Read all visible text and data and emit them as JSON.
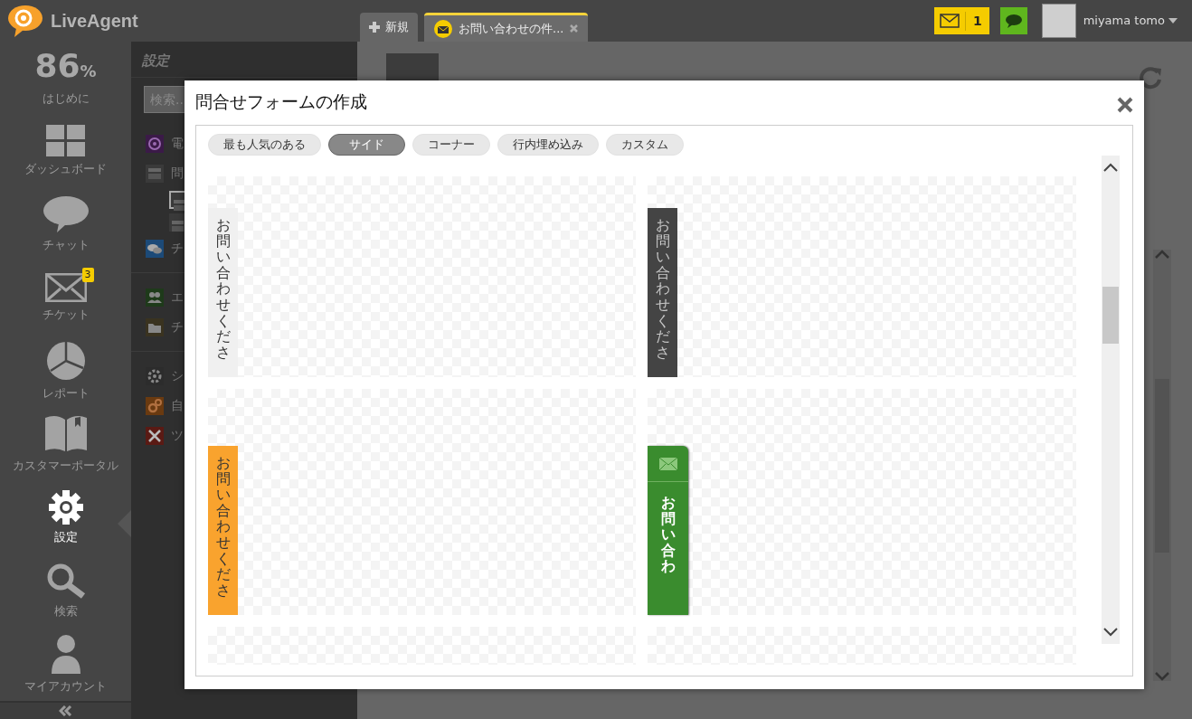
{
  "app": {
    "logo": "LiveAgent"
  },
  "tabs": [
    {
      "label": "新規",
      "kind": "new",
      "selected": false
    },
    {
      "label": "お問い合わせの件...",
      "kind": "ticket",
      "selected": true
    }
  ],
  "header": {
    "mail_count": "1",
    "user": "miyama tomo"
  },
  "nav": {
    "progress": "86",
    "progress_unit": "%",
    "progress_label": "はじめに",
    "items": [
      {
        "label": "ダッシュボード",
        "selected": false
      },
      {
        "label": "チャット",
        "selected": false
      },
      {
        "label": "チケット",
        "badge": "3",
        "selected": false
      },
      {
        "label": "レポート",
        "selected": false
      },
      {
        "label": "カスタマーポータル",
        "selected": false
      },
      {
        "label": "設定",
        "selected": true
      },
      {
        "label": "検索",
        "selected": false
      },
      {
        "label": "マイアカウント",
        "selected": false
      }
    ]
  },
  "settings_panel": {
    "title": "設定",
    "search": {
      "placeholder": "検索..."
    },
    "groups": [
      [
        {
          "label": "電",
          "color": "#3b1a48"
        },
        {
          "label": "問",
          "color": "#3a3a3a",
          "children": [
            {
              "selected": true
            },
            {
              "selected": false
            }
          ]
        },
        {
          "label": "チ",
          "color": "#1c4a78"
        }
      ],
      [
        {
          "label": "エ",
          "color": "#1e3a1a"
        },
        {
          "label": "チ",
          "color": "#3a3320"
        }
      ],
      [
        {
          "label": "シ",
          "color": "#2c2c2c"
        },
        {
          "label": "自",
          "color": "#6a3a10"
        },
        {
          "label": "ツ",
          "color": "#5a1a14"
        }
      ]
    ]
  },
  "modal": {
    "title": "問合せフォームの作成",
    "filters": [
      {
        "label": "最も人気のある",
        "selected": false
      },
      {
        "label": "サイド",
        "selected": true
      },
      {
        "label": "コーナー",
        "selected": false
      },
      {
        "label": "行内埋め込み",
        "selected": false
      },
      {
        "label": "カスタム",
        "selected": false
      }
    ],
    "previews": [
      {
        "button": {
          "kind": "plain",
          "color": "#f0f0f0",
          "label": "お問い合わせくださ"
        }
      },
      {
        "button": {
          "kind": "plain",
          "color": "#444444",
          "label": "お問い合わせくださ"
        }
      },
      {
        "button": {
          "kind": "plain",
          "color": "#f9a32e",
          "label": "お問い合わせくださ"
        }
      },
      {
        "button": {
          "kind": "envelope",
          "color": "#3a8c2e",
          "label": "お問い合わ"
        }
      }
    ]
  }
}
